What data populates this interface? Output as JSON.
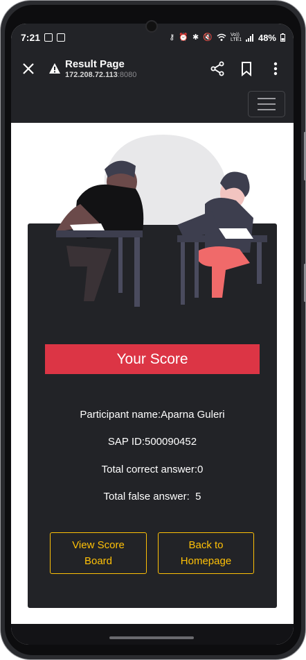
{
  "status_bar": {
    "time": "7:21",
    "battery": "48%",
    "network": "Vo)) LTE1"
  },
  "browser": {
    "page_title": "Result Page",
    "url_host": "172.208.72.113",
    "url_port": ":8080"
  },
  "result": {
    "heading": "Your Score",
    "participant": "Participant name:Aparna Guleri",
    "sap_id": "SAP ID:500090452",
    "correct": "Total correct answer:0",
    "false": "Total false answer:  5"
  },
  "buttons": {
    "view_score_board": "View Score Board",
    "back_to_homepage": "Back to Homepage"
  },
  "colors": {
    "dark": "#222327",
    "banner": "#dc3545",
    "accent": "#ffc107"
  }
}
